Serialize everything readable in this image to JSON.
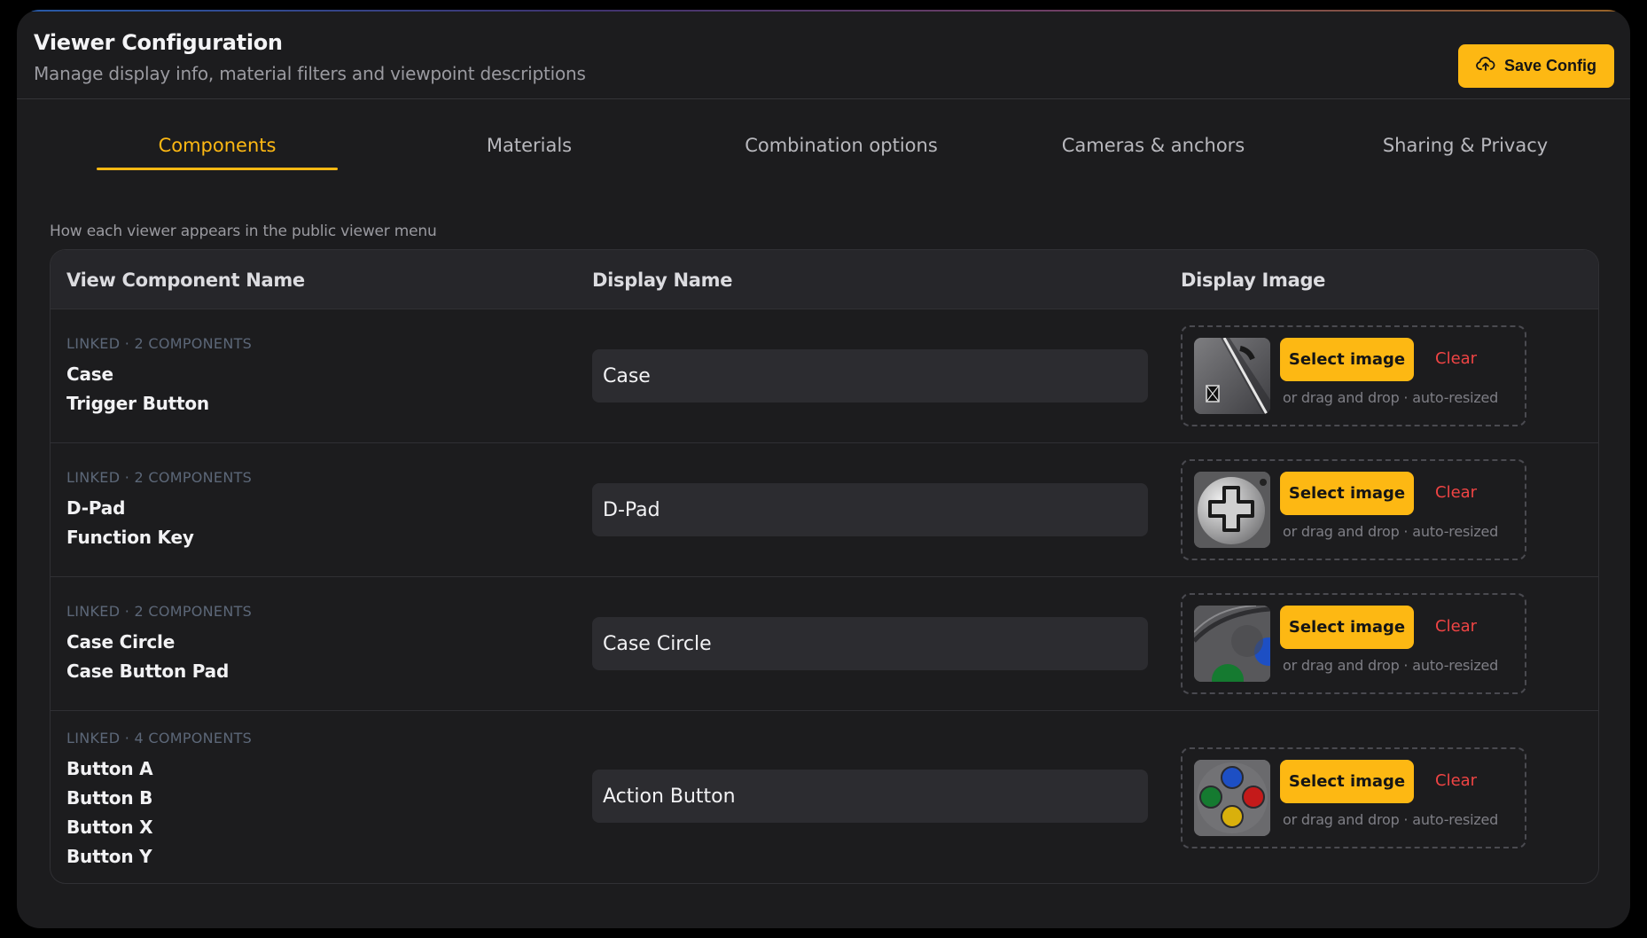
{
  "header": {
    "title": "Viewer Configuration",
    "subtitle": "Manage display info, material filters and viewpoint descriptions",
    "save_label": "Save Config"
  },
  "tabs": [
    {
      "label": "Components",
      "active": true
    },
    {
      "label": "Materials",
      "active": false
    },
    {
      "label": "Combination options",
      "active": false
    },
    {
      "label": "Cameras & anchors",
      "active": false
    },
    {
      "label": "Sharing & Privacy",
      "active": false
    }
  ],
  "section": {
    "description": "How each viewer appears in the public viewer menu"
  },
  "table": {
    "columns": [
      "View Component Name",
      "Display Name",
      "Display Image"
    ],
    "rows": [
      {
        "linked": "LINKED · 2 COMPONENTS",
        "components": [
          "Case",
          "Trigger Button"
        ],
        "display_name": "Case",
        "thumbnail": "case-image"
      },
      {
        "linked": "LINKED · 2 COMPONENTS",
        "components": [
          "D-Pad",
          "Function Key"
        ],
        "display_name": "D-Pad",
        "thumbnail": "dpad-image"
      },
      {
        "linked": "LINKED · 2 COMPONENTS",
        "components": [
          "Case Circle",
          "Case Button Pad"
        ],
        "display_name": "Case Circle",
        "thumbnail": "case-circle-image"
      },
      {
        "linked": "LINKED · 4 COMPONENTS",
        "components": [
          "Button A",
          "Button B",
          "Button X",
          "Button Y"
        ],
        "display_name": "Action Button",
        "thumbnail": "action-buttons-image"
      }
    ],
    "select_label": "Select image",
    "clear_label": "Clear",
    "hint": "or drag and drop · auto-resized"
  },
  "colors": {
    "accent": "#fdb813",
    "danger": "#ef4444",
    "background": "#1c1c1e",
    "linked_text": "#5c6778"
  }
}
